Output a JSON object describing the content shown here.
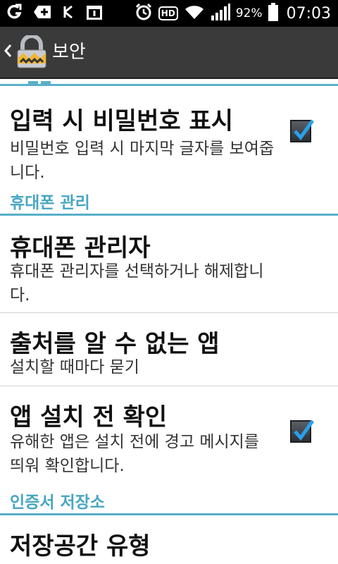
{
  "status_bar": {
    "left_icons": [
      "circle-arrow-icon",
      "plus-badge-icon",
      "usb-debug-icon",
      "calendar-icon"
    ],
    "right_icons": [
      "alarm-icon",
      "hd-voice-icon",
      "wifi-icon",
      "signal-icon"
    ],
    "hd_label": "HD",
    "battery_percent": "92%",
    "battery_level": 0.92,
    "time": "07:03"
  },
  "action_bar": {
    "back_icon": "chevron-left-icon",
    "app_icon": "lock-icon",
    "title": "보안"
  },
  "items": [
    {
      "title": "입력 시 비밀번호 표시",
      "subtitle": "비밀번호 입력 시 마지막 글자를 보여줍니다.",
      "checked": true
    },
    {
      "title": "휴대폰 관리자",
      "subtitle": "휴대폰 관리자를 선택하거나 해제합니다."
    },
    {
      "title": "출처를 알 수 없는 앱",
      "subtitle": "설치할 때마다 묻기"
    },
    {
      "title": "앱 설치 전 확인",
      "subtitle": "유해한 앱은 설치 전에 경고 메시지를 띄워 확인합니다.",
      "checked": true
    },
    {
      "title": "저장공간 유형"
    }
  ],
  "sections": [
    {
      "label": "휴대폰 관리"
    },
    {
      "label": "인증서 저장소"
    }
  ],
  "colors": {
    "accent": "#58b0c8",
    "section_text": "#48a6c2",
    "action_bar": "#3a3a3a",
    "status_bar": "#000000"
  }
}
